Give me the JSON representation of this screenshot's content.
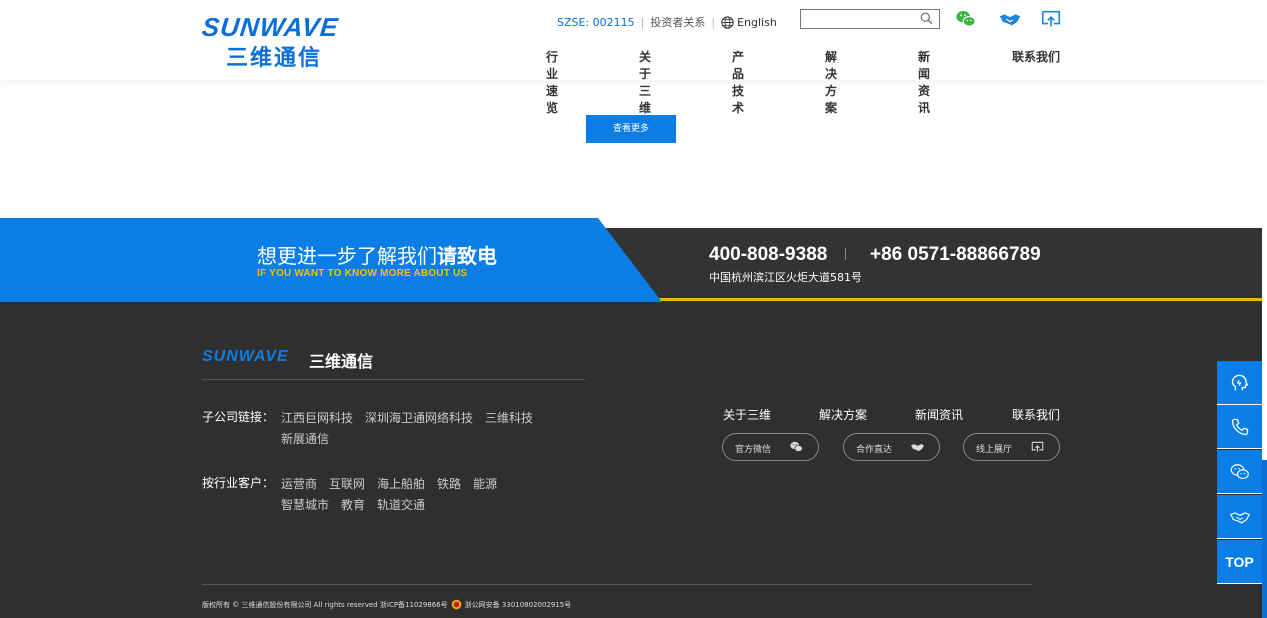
{
  "header": {
    "logo_en": "SUNWAVE",
    "logo_cn": "三维通信",
    "stock": "SZSE: 002115",
    "investor": "投资者关系",
    "language": "English",
    "search_placeholder": "",
    "nav": [
      "行业速览",
      "关于三维",
      "产品技术",
      "解决方案",
      "新闻资讯",
      "联系我们"
    ]
  },
  "main": {
    "more_button": "查看更多"
  },
  "band": {
    "title_normal": "想更进一步了解我们",
    "title_bold": "请致电",
    "subtitle": "IF YOU WANT TO KNOW MORE ABOUT US",
    "phone1": "400-808-9388",
    "phone2": "+86 0571-88866789",
    "address": "中国杭州滨江区火炬大道581号"
  },
  "footer": {
    "logo_en": "SUNWAVE",
    "logo_cn": "三维通信",
    "subsidiaries_label": "子公司链接：",
    "subsidiaries": [
      "江西巨网科技",
      "深圳海卫通网络科技",
      "三维科技",
      "新展通信"
    ],
    "customers_label": "按行业客户：",
    "customers": [
      "运营商",
      "互联网",
      "海上船舶",
      "铁路",
      "能源",
      "智慧城市",
      "教育",
      "轨道交通"
    ],
    "nav": [
      "关于三维",
      "解决方案",
      "新闻资讯",
      "联系我们"
    ],
    "pills": [
      "官方微信",
      "合作直达",
      "线上展厅"
    ],
    "copyright": "版权所有 © 三维通信股份有限公司 All rights reserved 浙ICP备11029866号",
    "police": "浙公网安备 33010802002915号"
  },
  "side": {
    "top_label": "TOP"
  },
  "colors": {
    "brand_blue": "#0a7ee6",
    "dark": "#2f2f2f",
    "accent_yellow": "#f0b400"
  }
}
